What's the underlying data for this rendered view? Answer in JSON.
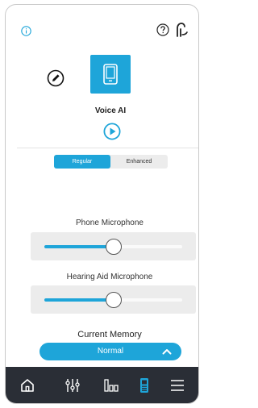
{
  "colors": {
    "accent": "#1ea5d9",
    "nav_background": "#2a2e36",
    "nav_icon": "#ffffff",
    "panel": "#ececec"
  },
  "header": {
    "icons": [
      "info-icon",
      "help-icon",
      "hearing-aid-icon"
    ]
  },
  "program": {
    "name": "Voice AI",
    "tile_icon": "phone-icon",
    "edit_icon": "pencil-icon",
    "play_icon": "play-icon"
  },
  "mode_toggle": {
    "options": [
      "Regular",
      "Enhanced"
    ],
    "selected": "Regular"
  },
  "sliders": [
    {
      "label": "Phone Microphone",
      "level": 0.5
    },
    {
      "label": "Hearing Aid Microphone",
      "level": 0.5
    }
  ],
  "memory": {
    "label": "Current Memory",
    "value": "Normal",
    "chevron": "chevron-up-icon"
  },
  "bottom_nav": {
    "items": [
      {
        "icon": "home-icon",
        "active": false
      },
      {
        "icon": "adjustments-icon",
        "active": false
      },
      {
        "icon": "equalizer-icon",
        "active": false
      },
      {
        "icon": "remote-icon",
        "active": true
      },
      {
        "icon": "menu-icon",
        "active": false
      }
    ]
  }
}
